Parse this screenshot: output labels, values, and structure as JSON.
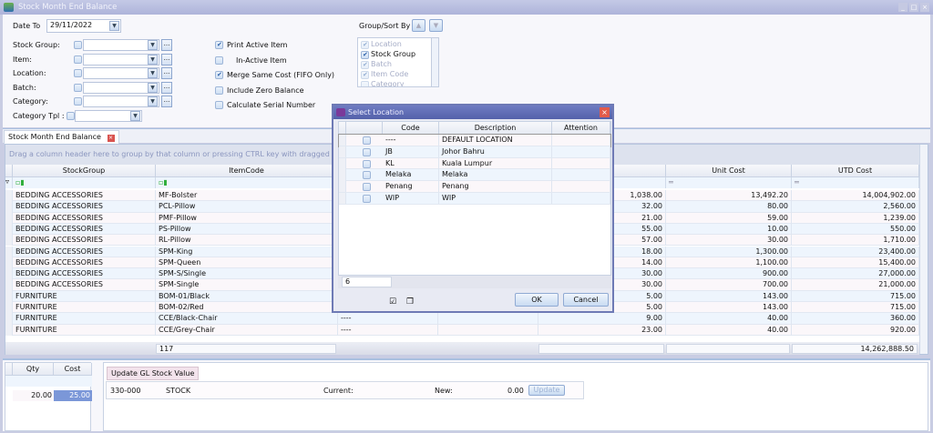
{
  "window": {
    "title": "Stock Month End Balance",
    "minimize": "_",
    "maximize": "□",
    "close": "×"
  },
  "form": {
    "date_label": "Date To",
    "date_value": "29/11/2022",
    "fields": [
      {
        "label": "Stock Group:"
      },
      {
        "label": "Item:"
      },
      {
        "label": "Location:"
      },
      {
        "label": "Batch:"
      },
      {
        "label": "Category:"
      }
    ],
    "category_tpl_label": "Category Tpl :",
    "options": [
      {
        "label": "Print Active Item",
        "checked": true
      },
      {
        "label": "In-Active Item",
        "checked": false
      },
      {
        "label": "Merge Same Cost (FIFO Only)",
        "checked": true
      },
      {
        "label": "Include Zero Balance",
        "checked": false
      },
      {
        "label": "Calculate Serial Number",
        "checked": false
      }
    ],
    "group_sort_label": "Group/Sort By :",
    "group_sort_items": [
      {
        "label": "Location",
        "checked": true,
        "enabled": false
      },
      {
        "label": "Stock Group",
        "checked": true,
        "enabled": true
      },
      {
        "label": "Batch",
        "checked": true,
        "enabled": false
      },
      {
        "label": "Item Code",
        "checked": true,
        "enabled": false
      },
      {
        "label": "Category",
        "checked": false,
        "enabled": false
      }
    ]
  },
  "tab": {
    "label": "Stock Month End Balance"
  },
  "grid": {
    "group_panel": "Drag a column header here to group by that column or pressing CTRL key with dragged column to m",
    "columns": [
      "StockGroup",
      "ItemCode",
      "",
      "",
      "",
      "Unit Cost",
      "UTD Cost"
    ],
    "rows": [
      [
        "BEDDING ACCESSORIES",
        "MF-Bolster",
        "",
        "",
        "1,038.00",
        "13,492.20",
        "14,004,902.00"
      ],
      [
        "BEDDING ACCESSORIES",
        "PCL-Pillow",
        "",
        "",
        "32.00",
        "80.00",
        "2,560.00"
      ],
      [
        "BEDDING ACCESSORIES",
        "PMF-Pillow",
        "",
        "",
        "21.00",
        "59.00",
        "1,239.00"
      ],
      [
        "BEDDING ACCESSORIES",
        "PS-Pillow",
        "",
        "",
        "55.00",
        "10.00",
        "550.00"
      ],
      [
        "BEDDING ACCESSORIES",
        "RL-Pillow",
        "",
        "",
        "57.00",
        "30.00",
        "1,710.00"
      ],
      [
        "BEDDING ACCESSORIES",
        "SPM-King",
        "",
        "",
        "18.00",
        "1,300.00",
        "23,400.00"
      ],
      [
        "BEDDING ACCESSORIES",
        "SPM-Queen",
        "",
        "",
        "14.00",
        "1,100.00",
        "15,400.00"
      ],
      [
        "BEDDING ACCESSORIES",
        "SPM-S/Single",
        "",
        "",
        "30.00",
        "900.00",
        "27,000.00"
      ],
      [
        "BEDDING ACCESSORIES",
        "SPM-Single",
        "",
        "",
        "30.00",
        "700.00",
        "21,000.00"
      ],
      [
        "FURNITURE",
        "BOM-01/Black",
        "",
        "",
        "5.00",
        "143.00",
        "715.00"
      ],
      [
        "FURNITURE",
        "BOM-02/Red",
        "",
        "",
        "5.00",
        "143.00",
        "715.00"
      ],
      [
        "FURNITURE",
        "CCE/Black-Chair",
        "----",
        "",
        "9.00",
        "40.00",
        "360.00"
      ],
      [
        "FURNITURE",
        "CCE/Grey-Chair",
        "----",
        "",
        "23.00",
        "40.00",
        "920.00"
      ]
    ],
    "footer_count": "117",
    "footer_total": "14,262,888.50"
  },
  "bottom": {
    "qty_header": "Qty",
    "cost_header": "Cost",
    "qty": "20.00",
    "cost": "25.00",
    "tab_label": "Update GL Stock Value",
    "account_code": "330-000",
    "account_name": "STOCK",
    "current_label": "Current:",
    "new_label": "New:",
    "new_value": "0.00",
    "update_button": "Update"
  },
  "dialog": {
    "title": "Select Location",
    "columns": [
      "Code",
      "Description",
      "Attention"
    ],
    "rows": [
      [
        "----",
        "DEFAULT LOCATION",
        ""
      ],
      [
        "JB",
        "Johor Bahru",
        ""
      ],
      [
        "KL",
        "Kuala Lumpur",
        ""
      ],
      [
        "Melaka",
        "Melaka",
        ""
      ],
      [
        "Penang",
        "Penang",
        ""
      ],
      [
        "WIP",
        "WIP",
        ""
      ]
    ],
    "count": "6",
    "ok": "OK",
    "cancel": "Cancel"
  }
}
